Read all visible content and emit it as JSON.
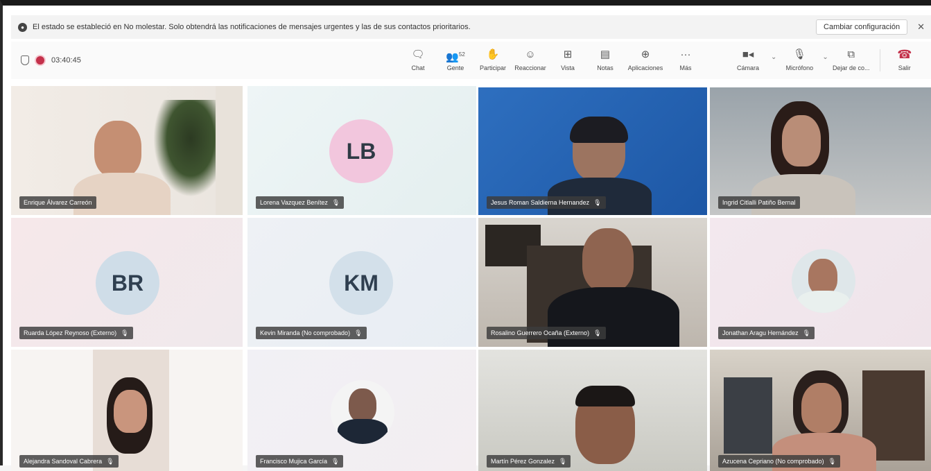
{
  "notification": {
    "text": "El estado se estableció en No molestar. Solo obtendrá las notificaciones de mensajes urgentes y las de sus contactos prioritarios.",
    "button": "Cambiar configuración",
    "close": "✕"
  },
  "meeting": {
    "timer": "03:40:45"
  },
  "toolbar": {
    "chat": "Chat",
    "people": "Gente",
    "people_count": "52",
    "raise": "Participar",
    "react": "Reaccionar",
    "view": "Vista",
    "notes": "Notas",
    "apps": "Aplicaciones",
    "more": "Más",
    "camera": "Cámara",
    "mic": "Micrófono",
    "share": "Dejar de co...",
    "leave": "Salir"
  },
  "participants": [
    {
      "name": "Enrique Álvarez Carreón",
      "initials": ""
    },
    {
      "name": "Lorena Vazquez Benítez",
      "initials": "LB"
    },
    {
      "name": "Jesus Roman Saldierna Hernandez",
      "initials": ""
    },
    {
      "name": "Ingrid Citlalli Patiño Bernal",
      "initials": ""
    },
    {
      "name": "Ruarda López Reynoso (Externo)",
      "initials": "BR"
    },
    {
      "name": "Kevin Miranda (No comprobado)",
      "initials": "KM"
    },
    {
      "name": "Rosalino Guerrero Ocaña (Externo)",
      "initials": ""
    },
    {
      "name": "Jonathan Aragu Hernández",
      "initials": ""
    },
    {
      "name": "Alejandra Sandoval Cabrera",
      "initials": ""
    },
    {
      "name": "Francisco Mujica García",
      "initials": ""
    },
    {
      "name": "Martín Pérez Gonzalez",
      "initials": ""
    },
    {
      "name": "Azucena Cepriano (No comprobado)",
      "initials": ""
    }
  ],
  "colors": {
    "accent_red": "#c4314b",
    "avatar_pink": "#f2c6dd",
    "avatar_blue": "#cfdde8"
  }
}
